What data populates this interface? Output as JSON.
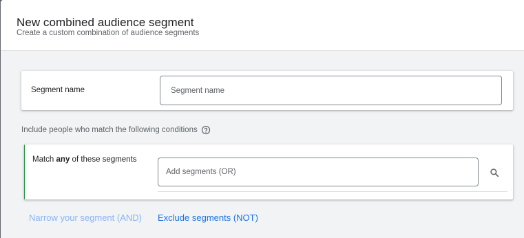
{
  "header": {
    "title": "New combined audience segment",
    "subtitle": "Create a custom combination of audience segments"
  },
  "segment_name": {
    "label": "Segment name",
    "placeholder": "Segment name",
    "value": ""
  },
  "conditions": {
    "label": "Include people who match the following conditions",
    "help_icon": "help-circle-icon"
  },
  "match_section": {
    "label_prefix": "Match",
    "label_emphasis": "any",
    "label_suffix": " of these segments",
    "input_placeholder": "Add segments (OR)",
    "search_icon": "search-icon",
    "accent_color": "#1e8e3e"
  },
  "actions": {
    "narrow_label": "Narrow your segment (AND)",
    "exclude_label": "Exclude segments (NOT)",
    "link_color": "#1a73e8",
    "disabled_link_color": "#8ab4f8"
  }
}
